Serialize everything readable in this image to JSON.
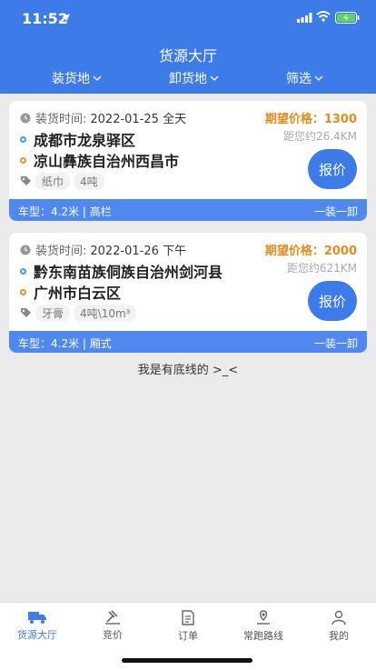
{
  "status": {
    "time": "11:52"
  },
  "header": {
    "title": "货源大厅",
    "filters": [
      "装货地",
      "卸货地",
      "筛选"
    ]
  },
  "orders": [
    {
      "time_label": "装货时间:",
      "time_value": "2022-01-25 全天",
      "price": "期望价格：1300",
      "distance": "距您约26.4KM",
      "load_city": "成都市龙泉驿区",
      "unload_city": "凉山彝族自治州西昌市",
      "tags": [
        "纸巾",
        "4吨"
      ],
      "quote_label": "报价",
      "vehicle": "车型：4.2米 | 高栏",
      "mode": "一装一卸"
    },
    {
      "time_label": "装货时间:",
      "time_value": "2022-01-26 下午",
      "price": "期望价格：2000",
      "distance": "距您约621KM",
      "load_city": "黔东南苗族侗族自治州剑河县",
      "unload_city": "广州市白云区",
      "tags": [
        "牙膏",
        "4吨\\10m³"
      ],
      "quote_label": "报价",
      "vehicle": "车型：4.2米 | 厢式",
      "mode": "一装一卸"
    }
  ],
  "footer_note": "我是有底线的 >_<",
  "tabs": [
    {
      "label": "货源大厅",
      "icon": "truck-icon"
    },
    {
      "label": "竞价",
      "icon": "gavel-icon"
    },
    {
      "label": "订单",
      "icon": "document-icon"
    },
    {
      "label": "常跑路线",
      "icon": "route-icon"
    },
    {
      "label": "我的",
      "icon": "user-icon"
    }
  ],
  "colors": {
    "primary": "#3d7be8",
    "price": "#e88a1a",
    "footer": "#4f89f0"
  }
}
